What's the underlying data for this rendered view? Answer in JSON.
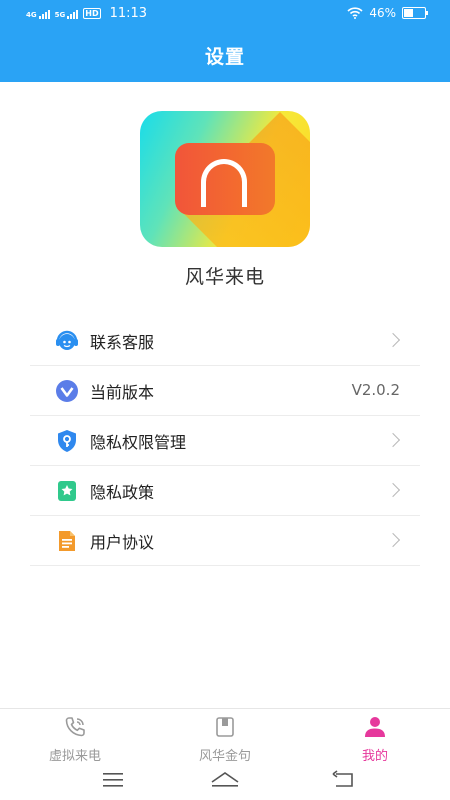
{
  "status_bar": {
    "signal_1": "4G",
    "signal_2": "5G",
    "hd": "HD",
    "time": "11:13",
    "battery_percent": "46%",
    "battery_level": 0.46
  },
  "header": {
    "title": "设置"
  },
  "app": {
    "name": "风华来电"
  },
  "settings": {
    "items": [
      {
        "label": "联系客服",
        "icon": "customer-service-icon",
        "value": ""
      },
      {
        "label": "当前版本",
        "icon": "version-icon",
        "value": "V2.0.2"
      },
      {
        "label": "隐私权限管理",
        "icon": "privacy-shield-icon",
        "value": ""
      },
      {
        "label": "隐私政策",
        "icon": "policy-icon",
        "value": ""
      },
      {
        "label": "用户协议",
        "icon": "document-icon",
        "value": ""
      }
    ]
  },
  "bottom_nav": {
    "tabs": [
      {
        "label": "虚拟来电",
        "icon": "phone-icon",
        "active": false
      },
      {
        "label": "风华金句",
        "icon": "book-icon",
        "active": false
      },
      {
        "label": "我的",
        "icon": "user-icon",
        "active": true
      }
    ]
  },
  "colors": {
    "header": "#2aa3f5",
    "active_tab": "#e6389c",
    "inactive_tab": "#9a9a9a"
  }
}
